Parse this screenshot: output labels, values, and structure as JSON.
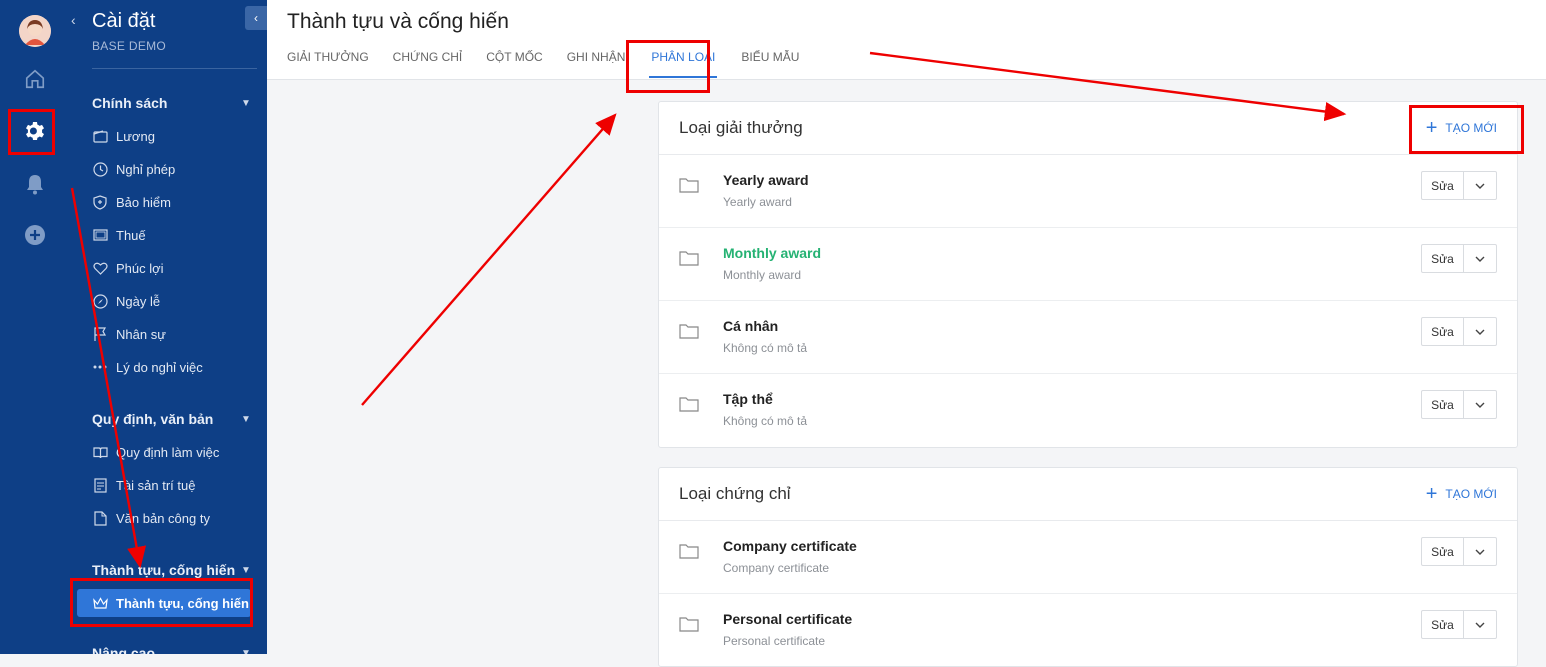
{
  "sidebar": {
    "title": "Cài đặt",
    "subtitle": "BASE DEMO",
    "sections": [
      {
        "label": "Chính sách",
        "items": [
          "Lương",
          "Nghỉ phép",
          "Bảo hiểm",
          "Thuế",
          "Phúc lợi",
          "Ngày lễ",
          "Nhân sự",
          "Lý do nghỉ việc"
        ]
      },
      {
        "label": "Quy định, văn bản",
        "items": [
          "Quy định làm việc",
          "Tài sản trí tuệ",
          "Văn bản công ty"
        ]
      },
      {
        "label": "Thành tựu, cống hiến",
        "items": [
          "Thành tựu, cống hiến"
        ]
      },
      {
        "label": "Nâng cao"
      }
    ]
  },
  "page": {
    "title": "Thành tựu và cống hiến",
    "tabs": [
      "GIẢI THƯỞNG",
      "CHỨNG CHỈ",
      "CỘT MỐC",
      "GHI NHẬN",
      "PHÂN LOẠI",
      "BIỂU MẪU"
    ],
    "active_tab": "PHÂN LOẠI"
  },
  "cards": [
    {
      "title": "Loại giải thưởng",
      "create_label": "TẠO MỚI",
      "rows": [
        {
          "name": "Yearly award",
          "desc": "Yearly award"
        },
        {
          "name": "Monthly award",
          "desc": "Monthly award"
        },
        {
          "name": "Cá nhân",
          "desc": "Không có mô tả"
        },
        {
          "name": "Tập thể",
          "desc": "Không có mô tả"
        }
      ]
    },
    {
      "title": "Loại chứng chỉ",
      "create_label": "TẠO MỚI",
      "rows": [
        {
          "name": "Company certificate",
          "desc": "Company certificate"
        },
        {
          "name": "Personal certificate",
          "desc": "Personal certificate"
        }
      ]
    }
  ],
  "edit_label": "Sửa",
  "colors": {
    "sidebar": "#0e3f86",
    "accent": "#2f76d8",
    "highlight": "#25b273",
    "annotation": "#e00000"
  }
}
